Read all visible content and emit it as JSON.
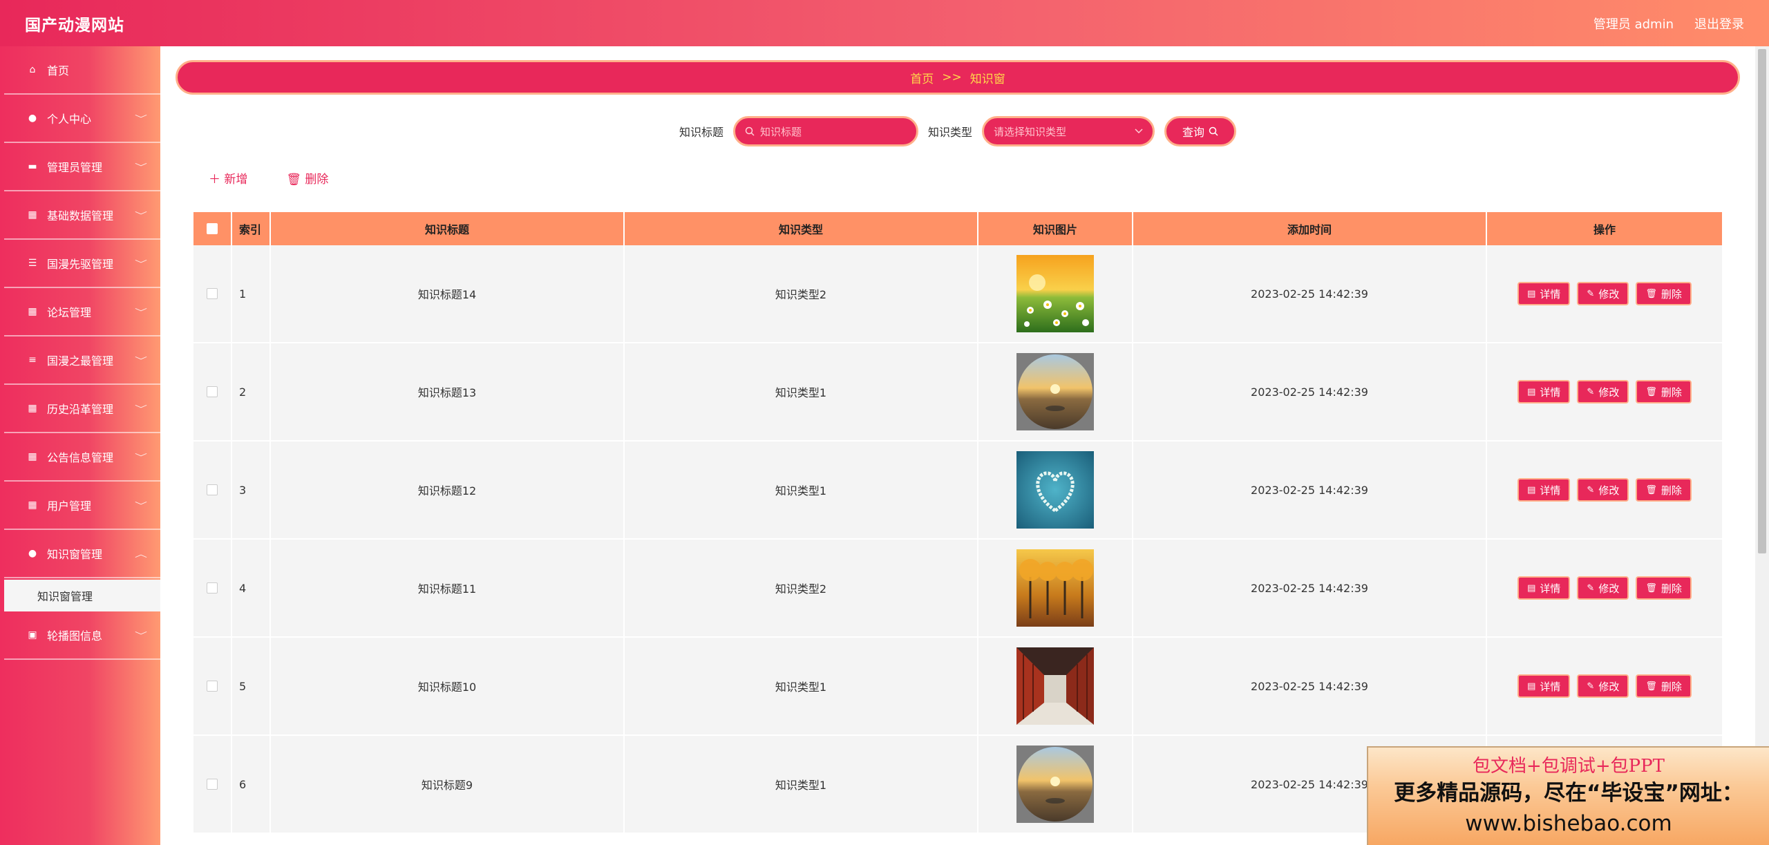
{
  "header": {
    "title": "国产动漫网站",
    "admin": "管理员 admin",
    "logout": "退出登录"
  },
  "sidebar": {
    "items": [
      {
        "label": "首页",
        "icon": "home-icon",
        "glyph": "⌂",
        "arrow": ""
      },
      {
        "label": "个人中心",
        "icon": "user-icon",
        "glyph": "●",
        "arrow": "﹀"
      },
      {
        "label": "管理员管理",
        "icon": "briefcase-icon",
        "glyph": "▬",
        "arrow": "﹀"
      },
      {
        "label": "基础数据管理",
        "icon": "grid-icon",
        "glyph": "▦",
        "arrow": "﹀"
      },
      {
        "label": "国漫先驱管理",
        "icon": "sliders-icon",
        "glyph": "☰",
        "arrow": "﹀"
      },
      {
        "label": "论坛管理",
        "icon": "grid-icon",
        "glyph": "▦",
        "arrow": "﹀"
      },
      {
        "label": "国漫之最管理",
        "icon": "list-icon",
        "glyph": "≡",
        "arrow": "﹀"
      },
      {
        "label": "历史沿革管理",
        "icon": "grid-icon",
        "glyph": "▦",
        "arrow": "﹀"
      },
      {
        "label": "公告信息管理",
        "icon": "grid-icon",
        "glyph": "▦",
        "arrow": "﹀"
      },
      {
        "label": "用户管理",
        "icon": "grid-icon",
        "glyph": "▦",
        "arrow": "﹀"
      },
      {
        "label": "知识窗管理",
        "icon": "location-icon",
        "glyph": "●",
        "arrow": "︿"
      }
    ],
    "submenu_label": "知识窗管理",
    "last_item": {
      "label": "轮播图信息",
      "icon": "image-icon",
      "glyph": "▣",
      "arrow": "﹀"
    }
  },
  "breadcrumb": {
    "home": "首页",
    "sep": ">>",
    "current": "知识窗"
  },
  "search": {
    "title_label": "知识标题",
    "title_placeholder": "知识标题",
    "type_label": "知识类型",
    "type_placeholder": "请选择知识类型",
    "query_label": "查询"
  },
  "actions": {
    "add": "新增",
    "delete": "删除"
  },
  "table": {
    "headers": {
      "index": "索引",
      "title": "知识标题",
      "type": "知识类型",
      "image": "知识图片",
      "time": "添加时间",
      "op": "操作"
    },
    "buttons": {
      "detail": "详情",
      "edit": "修改",
      "delete": "删除"
    },
    "rows": [
      {
        "index": "1",
        "title": "知识标题14",
        "type": "知识类型2",
        "time": "2023-02-25 14:42:39",
        "image": "daisy-field"
      },
      {
        "index": "2",
        "title": "知识标题13",
        "type": "知识类型1",
        "time": "2023-02-25 14:42:39",
        "image": "sunset-globe"
      },
      {
        "index": "3",
        "title": "知识标题12",
        "type": "知识类型1",
        "time": "2023-02-25 14:42:39",
        "image": "heart-island"
      },
      {
        "index": "4",
        "title": "知识标题11",
        "type": "知识类型2",
        "time": "2023-02-25 14:42:39",
        "image": "autumn-trees"
      },
      {
        "index": "5",
        "title": "知识标题10",
        "type": "知识类型1",
        "time": "2023-02-25 14:42:39",
        "image": "red-corridor"
      },
      {
        "index": "6",
        "title": "知识标题9",
        "type": "知识类型1",
        "time": "2023-02-25 14:42:39",
        "image": "sunset-globe"
      }
    ]
  },
  "ad": {
    "line1": "包文档+包调试+包PPT",
    "line2": "更多精品源码，尽在“毕设宝”网址：",
    "line3": "www.bishebao.com"
  },
  "colors": {
    "primary": "#e8285a",
    "accent_border": "#ffb08a",
    "table_header": "#ff9166",
    "breadcrumb_text": "#ffd84a"
  }
}
